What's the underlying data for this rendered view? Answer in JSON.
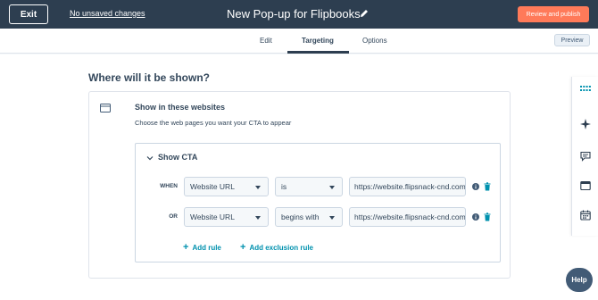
{
  "topbar": {
    "exit_label": "Exit",
    "unsaved_label": "No unsaved changes",
    "title": "New Pop-up for Flipbooks",
    "publish_label": "Review and publish"
  },
  "tabs": {
    "edit": "Edit",
    "targeting": "Targeting",
    "options": "Options",
    "active": "Targeting"
  },
  "preview_label": "Preview",
  "section": {
    "heading": "Where will it be shown?"
  },
  "card": {
    "title": "Show in these websites",
    "subtitle": "Choose the web pages you want your CTA to appear",
    "inner": {
      "header": "Show CTA",
      "rules": [
        {
          "label": "WHEN",
          "field": "Website URL",
          "operator": "is",
          "value": "https://website.flipsnack-cnd.com"
        },
        {
          "label": "OR",
          "field": "Website URL",
          "operator": "begins with",
          "value": "https://website.flipsnack-cnd.com"
        }
      ],
      "add_rule": "Add rule",
      "add_exclusion_rule": "Add exclusion rule"
    }
  },
  "right_sidebar": {
    "icons": [
      "apps-grid-icon",
      "ai-sparkle-icon",
      "chat-icon",
      "panel-icon",
      "calendar-icon"
    ]
  },
  "help_label": "Help",
  "colors": {
    "topbar": "#2d3e50",
    "publish": "#ff7a59",
    "link": "#0091ae",
    "text": "#33475b"
  }
}
